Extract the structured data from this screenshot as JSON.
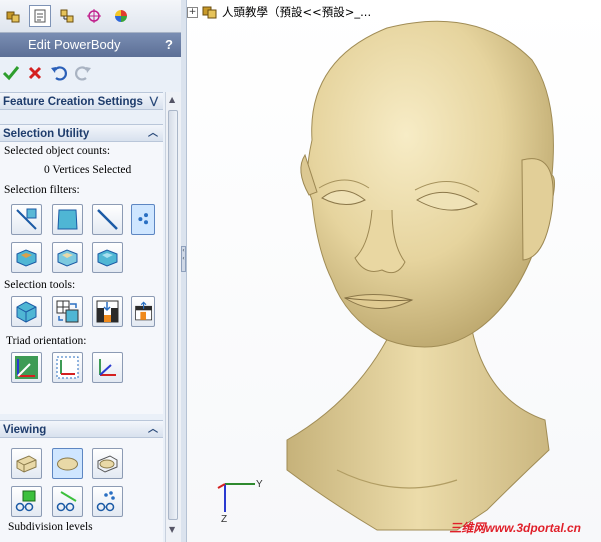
{
  "panel": {
    "title": "Edit PowerBody",
    "help": "?",
    "tabs": [
      "feature-manager-icon",
      "property-manager-icon",
      "configuration-manager-icon",
      "dimxpert-icon",
      "display-manager-icon"
    ],
    "actions": [
      "ok-icon",
      "cancel-icon",
      "undo-icon",
      "redo-icon"
    ]
  },
  "groups": {
    "feature_creation": {
      "title": "Feature Creation Settings",
      "chevron": "⋁"
    },
    "selection_utility": {
      "title": "Selection Utility",
      "chevron": "︿",
      "counts_label": "Selected object counts:",
      "counts_value": "0 Vertices Selected",
      "filters_label": "Selection filters:",
      "tools_label": "Selection tools:",
      "triad_label": "Triad orientation:"
    },
    "viewing": {
      "title": "Viewing",
      "chevron": "︿",
      "subdivision_label": "Subdivision levels"
    }
  },
  "tree": {
    "plus": "+",
    "text": "人頭教學（預設<<預設>_..."
  },
  "watermark": "三维网www.3dportal.cn",
  "triad": {
    "y_label": "Y",
    "z_label": "Z"
  },
  "colors": {
    "model": "#e9d9a7",
    "header_bar": "#6d81a8",
    "selected": "#cfe6ff",
    "watermark": "#e0202a"
  }
}
